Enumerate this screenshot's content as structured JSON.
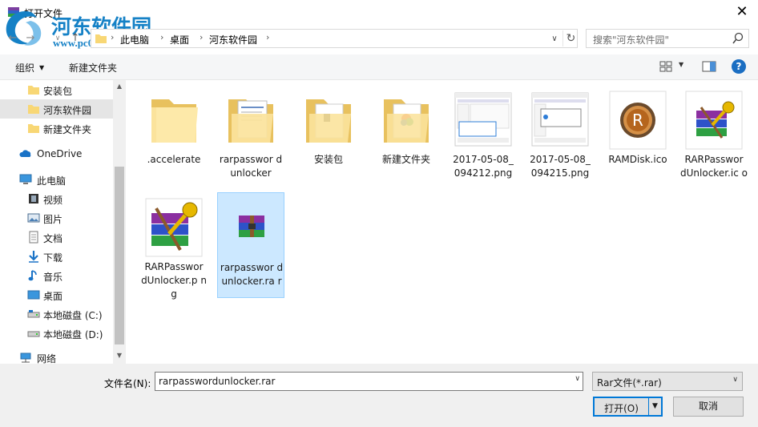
{
  "window": {
    "title": "打开文件",
    "close_glyph": "✕"
  },
  "watermark": {
    "name": "河东软件园",
    "url": "www.pc0359.cn"
  },
  "address": {
    "breadcrumbs": [
      "此电脑",
      "桌面",
      "河东软件园"
    ],
    "separator": "›"
  },
  "search": {
    "placeholder": "搜索\"河东软件园\""
  },
  "toolbar": {
    "organize_label": "组织",
    "new_folder_label": "新建文件夹"
  },
  "nav": {
    "items": [
      {
        "label": "安装包",
        "icon": "folder-icon"
      },
      {
        "label": "河东软件园",
        "icon": "folder-icon",
        "selected": true
      },
      {
        "label": "新建文件夹",
        "icon": "folder-icon"
      },
      {
        "label": "OneDrive",
        "icon": "cloud-icon"
      },
      {
        "label": "此电脑",
        "icon": "computer-icon"
      },
      {
        "label": "视频",
        "icon": "video-icon"
      },
      {
        "label": "图片",
        "icon": "picture-icon"
      },
      {
        "label": "文档",
        "icon": "document-icon"
      },
      {
        "label": "下载",
        "icon": "download-icon"
      },
      {
        "label": "音乐",
        "icon": "music-icon"
      },
      {
        "label": "桌面",
        "icon": "desktop-icon"
      },
      {
        "label": "本地磁盘 (C:)",
        "icon": "drive-icon"
      },
      {
        "label": "本地磁盘 (D:)",
        "icon": "drive-icon"
      },
      {
        "label": "网络",
        "icon": "network-icon"
      }
    ]
  },
  "files": [
    {
      "name": ".accelerate",
      "kind": "folder-empty"
    },
    {
      "name": "rarpassworddunlocker",
      "display": "rarpasswor dunlocker",
      "kind": "folder-docs"
    },
    {
      "name": "安装包",
      "kind": "folder-icon-file"
    },
    {
      "name": "新建文件夹",
      "kind": "folder-colorful"
    },
    {
      "name": "2017-05-08_094212.png",
      "display": "2017-05-08_ 094212.png",
      "kind": "screenshot"
    },
    {
      "name": "2017-05-08_094215.png",
      "display": "2017-05-08_ 094215.png",
      "kind": "screenshot"
    },
    {
      "name": "RAMDisk.ico",
      "kind": "ramdisk"
    },
    {
      "name": "RARPasswordUnlocker.ico",
      "display": "RARPasswor dUnlocker.ic o",
      "kind": "winrar-key"
    },
    {
      "name": "RARPasswordUnlocker.png",
      "display": "RARPasswor dUnlocker.p ng",
      "kind": "winrar-key-large"
    },
    {
      "name": "rarpassworddunlocker.rar",
      "display": "rarpasswor dunlocker.ra r",
      "kind": "winrar",
      "selected": true
    }
  ],
  "bottom": {
    "filename_label": "文件名(N):",
    "filename_value": "rarpasswordunlocker.rar",
    "filetype_value": "Rar文件(*.rar)",
    "open_label": "打开(O)",
    "cancel_label": "取消"
  },
  "colors": {
    "accent": "#0078d7",
    "selection": "#cce8ff",
    "folder": "#f8d775",
    "watermark": "#1581c6"
  }
}
